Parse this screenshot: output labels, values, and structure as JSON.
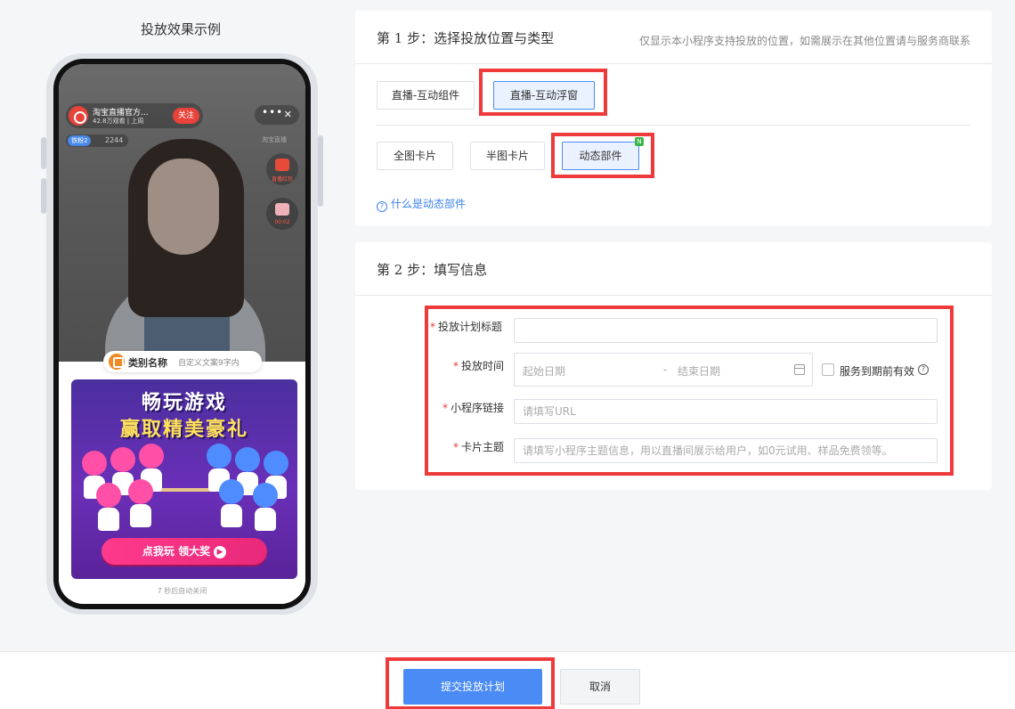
{
  "preview": {
    "title": "投放效果示例",
    "anchor_name": "淘宝直播官方...",
    "anchor_sub": "42.8万观看 | 上周",
    "follow_label": "关注",
    "top_dots": "•••",
    "top_close": "✕",
    "level_label": "铁粉2",
    "level_count": "2244",
    "side_tag": "淘宝直播",
    "side_btn1_label": "直播红包",
    "side_btn2_label": "00:02",
    "category_name": "类别名称",
    "category_desc": "自定义文案9字内",
    "promo_line1": "畅玩游戏",
    "promo_line2": "赢取精美豪礼",
    "promo_button": "点我玩 领大奖",
    "promo_arrow": "▶",
    "auto_close": "7 秒后自动关闭"
  },
  "step1": {
    "title": "第 1 步：选择投放位置与类型",
    "note": "仅显示本小程序支持投放的位置，如需展示在其他位置请与服务商联系",
    "positions": [
      {
        "label": "直播-互动组件",
        "active": false
      },
      {
        "label": "直播-互动浮窗",
        "active": true
      }
    ],
    "types": [
      {
        "label": "全图卡片",
        "active": false
      },
      {
        "label": "半图卡片",
        "active": false
      },
      {
        "label": "动态部件",
        "active": true,
        "badge": "N"
      }
    ],
    "help_q": "?",
    "help_link": "什么是动态部件"
  },
  "step2": {
    "title": "第 2 步：填写信息",
    "required_mark": "*",
    "fields": {
      "plan_title_label": "投放计划标题",
      "plan_title_placeholder": "",
      "time_label": "投放时间",
      "start_placeholder": "起始日期",
      "range_sep": "-",
      "end_placeholder": "结束日期",
      "service_valid_label": "服务到期前有效",
      "service_valid_q": "?",
      "link_label": "小程序链接",
      "link_placeholder": "请填写URL",
      "theme_label": "卡片主题",
      "theme_placeholder": "请填写小程序主题信息，用以直播间展示给用户，如0元试用、样品免费领等。"
    }
  },
  "footer": {
    "submit_label": "提交投放计划",
    "cancel_label": "取消"
  },
  "colors": {
    "primary": "#4a8bf5",
    "highlight_red": "#ee3a3a",
    "link_blue": "#3b82f0"
  }
}
